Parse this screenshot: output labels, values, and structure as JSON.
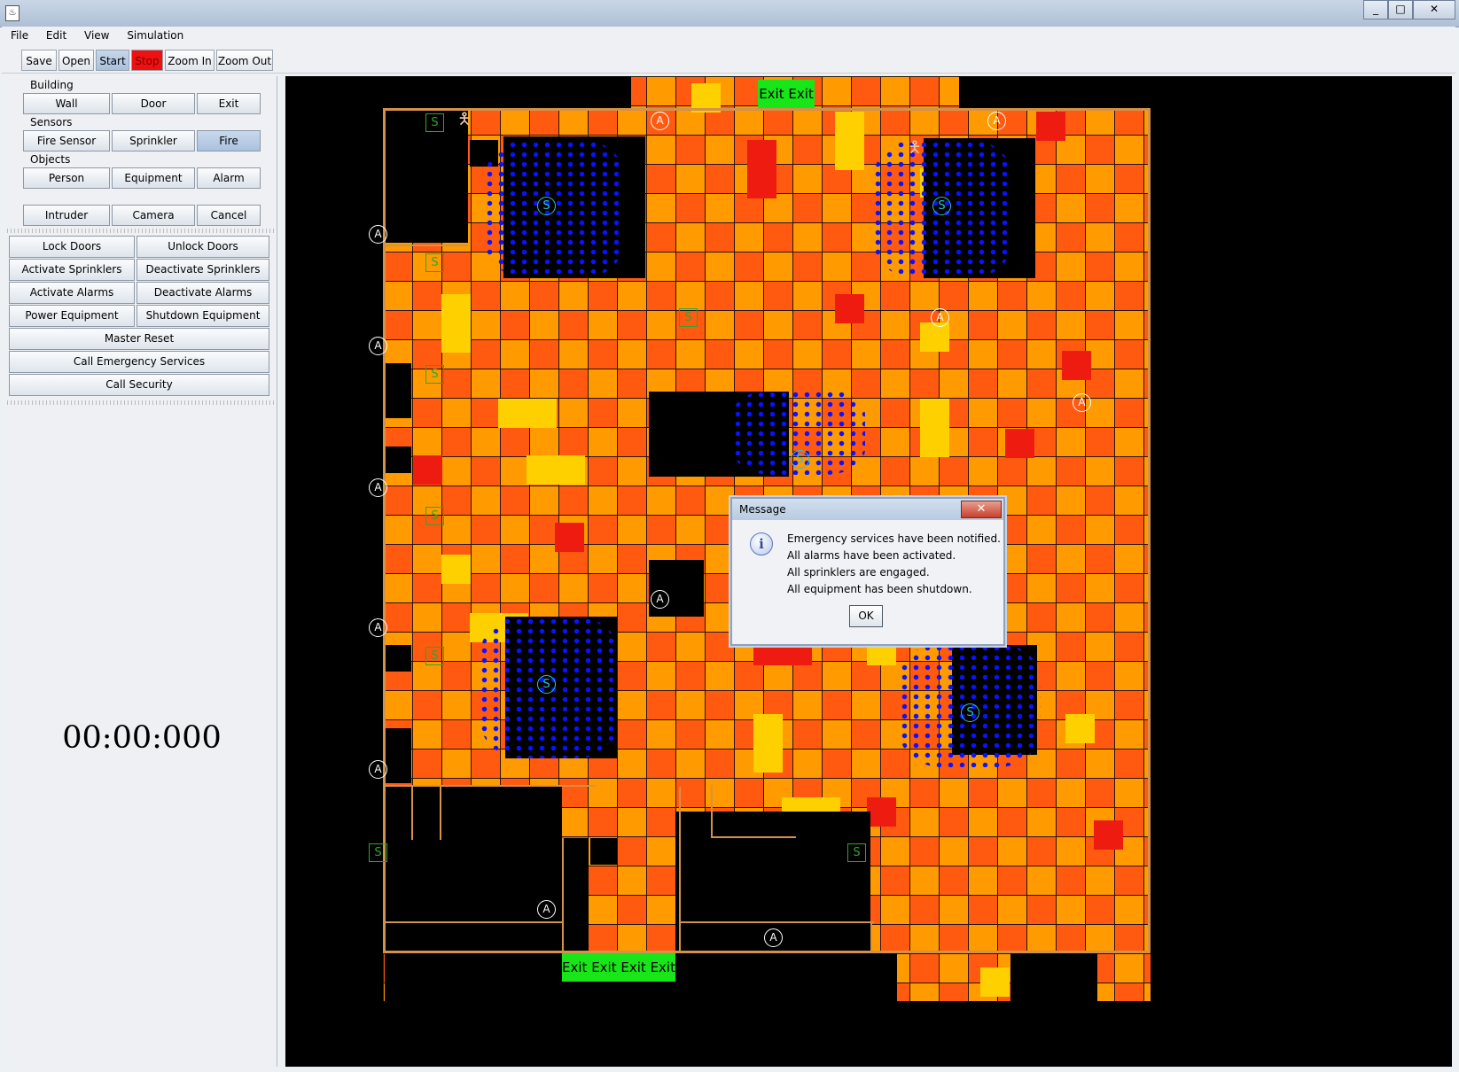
{
  "window": {
    "icon": "java-icon",
    "controls": [
      "_",
      "□",
      "✕"
    ]
  },
  "menu": [
    "File",
    "Edit",
    "View",
    "Simulation"
  ],
  "toolbar": {
    "save": "Save",
    "open": "Open",
    "start": "Start",
    "stop": "Stop",
    "zoom_in": "Zoom In",
    "zoom_out": "Zoom Out",
    "stop_color": "#ee1111"
  },
  "panel": {
    "building": {
      "heading": "Building",
      "buttons": [
        "Wall",
        "Door",
        "Exit"
      ]
    },
    "sensors": {
      "heading": "Sensors",
      "buttons": [
        "Fire Sensor",
        "Sprinkler",
        "Fire"
      ],
      "selected": "Fire"
    },
    "objects": {
      "heading": "Objects",
      "buttons": [
        "Person",
        "Equipment",
        "Alarm"
      ]
    },
    "misc": [
      "Intruder",
      "Camera",
      "Cancel"
    ],
    "actions": [
      [
        "Lock Doors",
        "Unlock Doors"
      ],
      [
        "Activate Sprinklers",
        "Deactivate Sprinklers"
      ],
      [
        "Activate Alarms",
        "Deactivate Alarms"
      ],
      [
        "Power Equipment",
        "Shutdown Equipment"
      ]
    ],
    "master_reset": "Master Reset",
    "call_emergency": "Call Emergency Services",
    "call_security": "Call Security",
    "timer": "00:00:000"
  },
  "map": {
    "exit_label": "Exit",
    "alarm_label": "A",
    "sprinkler_label": "S",
    "fire_colors": [
      "#ffd000",
      "#ff9a00",
      "#ff5a10",
      "#ee1c10"
    ],
    "people_color": "#0a12ff",
    "wall_color": "#d3924a",
    "exit_color": "#19e619"
  },
  "dialog": {
    "title": "Message",
    "close": "✕",
    "icon": "info-icon",
    "lines": [
      "Emergency services have been notified.",
      "All alarms have been activated.",
      "All sprinklers are engaged.",
      "All equipment has been shutdown."
    ],
    "ok": "OK"
  }
}
